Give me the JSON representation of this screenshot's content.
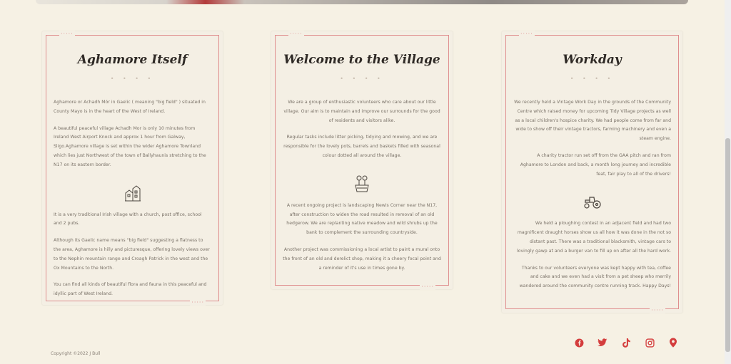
{
  "cards": [
    {
      "title": "Aghamore Itself",
      "paragraphs_top": [
        "Aghamore or Achadh Mór in Gaelic ( meaning \"big field\" ) situated in County Mayo is in the heart of the West of Ireland.",
        "A beautiful peaceful village Achadh Mor is only 10 minutes from Ireland West Airport Knock and approx 1 hour from Galway, Sligo.Aghamore village is set within the wider Aghamore Townland which lies just Northwest of the town of Ballyhaunis stretching to the N17 on its eastern border."
      ],
      "icon": "village-houses-icon",
      "paragraphs_bottom": [
        "It is a very traditional Irish village with a church, post office, school and 2 pubs.",
        "Although its Gaelic name means \"big field\" suggesting a flatness to the area, Aghamore is hilly and picturesque, offering lovely views over to the Nephin mountain range and Croagh Patrick in the west and the Ox Mountains to the North.",
        "You can find all kinds of beautiful flora and fauna in this peaceful and idyllic part of West Ireland."
      ]
    },
    {
      "title": "Welcome to the Village",
      "paragraphs_top": [
        "We are a group of enthusiastic volunteers who care about our little village. Our aim is to maintain and improve our surrounds for the good of residents and visitors alike.",
        "Regular tasks include litter picking, tidying and mowing, and we are responsible for the lovely pots, barrels and baskets filled with seasonal colour dotted all around the village."
      ],
      "icon": "flower-planter-icon",
      "paragraphs_bottom": [
        "A recent ongoing project is landscaping Newis Corner near the N17, after construction to widen the road resulted in removal of an old hedgerow. We are replanting native meadow and wild shrubs up the bank to complement the surrounding countryside.",
        "Another project was commissioning a local artist to paint a mural onto the front of an old and derelict shop, making it a cheery focal point and a reminder of it's use in times gone by."
      ]
    },
    {
      "title": "Workday",
      "paragraphs_top": [
        "We recently held a Vintage Work Day in the grounds of the Community Centre which raised money for upcoming Tidy Village projects as well as a local children's hospice charity. We had people come from far and wide to show off their vintage tractors, farming machinery and even a steam engine.",
        "A charity tractor run set off from the GAA pitch and ran from Aghamore to London and back, a month long journey and incredible feat, fair play to all of the drivers!"
      ],
      "icon": "tractor-icon",
      "paragraphs_bottom": [
        "We held a ploughing contest in an adjacent field and had two magnificent draught horses show us all how it was done in the not so distant past. There was a traditional blacksmith, vintage cars to lovingly gawp at and a burger van to fill up on after all the hard work.",
        "Thanks to our volunteers everyone was kept happy with tea, coffee and cake and we even had a visit from a pet sheep who merrily wandered around the community centre running track. Happy Days!"
      ]
    }
  ],
  "footer": {
    "copyright": "Copyright ©2022 J Bull",
    "social": [
      "facebook-icon",
      "twitter-icon",
      "tiktok-icon",
      "instagram-icon",
      "map-pin-icon"
    ],
    "social_color": "#d43d3d"
  },
  "colors": {
    "background": "#f6f1e4",
    "card": "#f4efe4",
    "frame": "#df8e8e",
    "title": "#2f2a26"
  }
}
